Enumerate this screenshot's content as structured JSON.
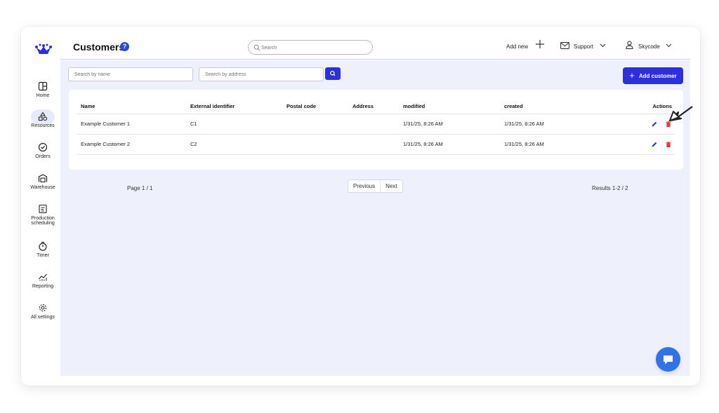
{
  "sidebar": {
    "items": [
      {
        "label": "Home",
        "icon": "layout-icon"
      },
      {
        "label": "Resources",
        "icon": "shapes-icon",
        "active": true
      },
      {
        "label": "Orders",
        "icon": "check-circle-icon"
      },
      {
        "label": "Warehouse",
        "icon": "warehouse-icon"
      },
      {
        "label": "Production scheduling",
        "icon": "schedule-icon"
      },
      {
        "label": "Timer",
        "icon": "stopwatch-icon"
      },
      {
        "label": "Reporting",
        "icon": "chart-icon"
      },
      {
        "label": "All settings",
        "icon": "gear-icon"
      }
    ]
  },
  "header": {
    "title": "Customers",
    "help": "?",
    "search_placeholder": "Search",
    "add_new": "Add new",
    "support": "Support",
    "user": "Skycode"
  },
  "filters": {
    "name_placeholder": "Search by name",
    "address_placeholder": "Search by address",
    "add_customer": "Add customer"
  },
  "table": {
    "columns": [
      "Name",
      "External identifier",
      "Postal code",
      "Address",
      "modified",
      "created",
      "Actions"
    ],
    "rows": [
      {
        "name": "Example Customer 1",
        "external_id": "C1",
        "postal_code": "",
        "address": "",
        "modified": "1/31/25, 8:26 AM",
        "created": "1/31/25, 8:26 AM"
      },
      {
        "name": "Example Customer 2",
        "external_id": "C2",
        "postal_code": "",
        "address": "",
        "modified": "1/31/25, 8:26 AM",
        "created": "1/31/25, 8:26 AM"
      }
    ]
  },
  "pagination": {
    "page": "Page 1 / 1",
    "previous": "Previous",
    "next": "Next",
    "results": "Results 1-2 / 2"
  },
  "colors": {
    "accent": "#2b2fe0",
    "danger": "#e53935",
    "content_bg": "#eef0fb"
  }
}
